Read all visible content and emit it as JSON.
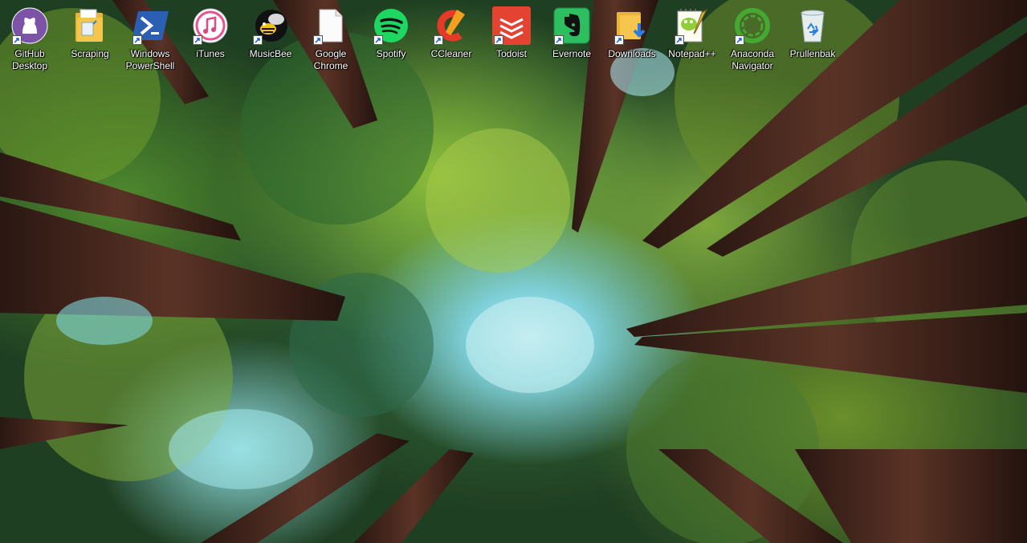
{
  "desktop": {
    "icons": [
      {
        "label": "GitHub Desktop",
        "icon": "github-icon",
        "shortcut": true
      },
      {
        "label": "Scraping",
        "icon": "folder-icon",
        "shortcut": false
      },
      {
        "label": "Windows PowerShell",
        "icon": "powershell-icon",
        "shortcut": true
      },
      {
        "label": "iTunes",
        "icon": "itunes-icon",
        "shortcut": true
      },
      {
        "label": "MusicBee",
        "icon": "musicbee-icon",
        "shortcut": true
      },
      {
        "label": "Google Chrome",
        "icon": "file-icon",
        "shortcut": true
      },
      {
        "label": "Spotify",
        "icon": "spotify-icon",
        "shortcut": true
      },
      {
        "label": "CCleaner",
        "icon": "ccleaner-icon",
        "shortcut": true
      },
      {
        "label": "Todoist",
        "icon": "todoist-icon",
        "shortcut": true
      },
      {
        "label": "Evernote",
        "icon": "evernote-icon",
        "shortcut": true
      },
      {
        "label": "Downloads",
        "icon": "downloads-folder-icon",
        "shortcut": true
      },
      {
        "label": "Notepad++",
        "icon": "notepadpp-icon",
        "shortcut": true
      },
      {
        "label": "Anaconda Navigator",
        "icon": "anaconda-icon",
        "shortcut": true
      },
      {
        "label": "Prullenbak",
        "icon": "recycle-bin-icon",
        "shortcut": false
      }
    ]
  },
  "colors": {
    "github": "#6e4c9c",
    "spotify": "#1ed760",
    "todoist": "#e44332",
    "evernote": "#2dbe60",
    "anaconda": "#44a833",
    "folder": "#f5c64b"
  }
}
